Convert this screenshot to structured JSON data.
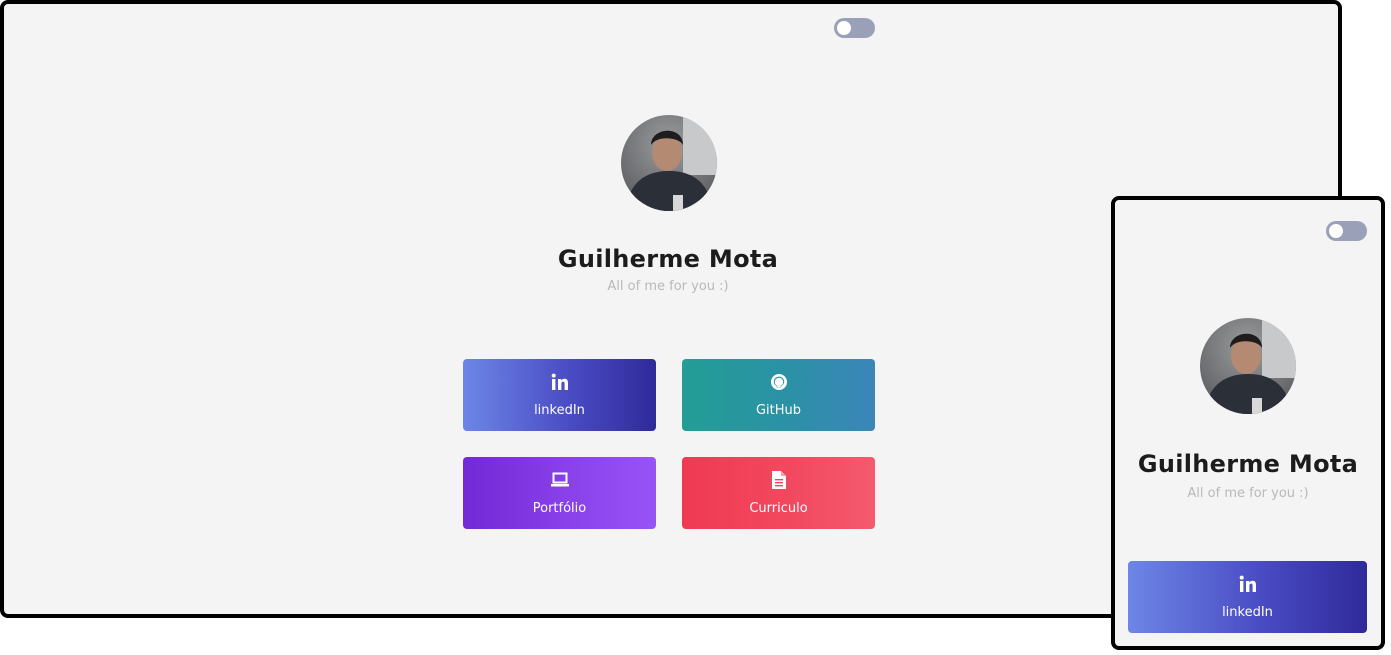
{
  "profile": {
    "name": "Guilherme Mota",
    "tagline": "All of me for you :)"
  },
  "theme_toggle": {
    "state": "off"
  },
  "links": [
    {
      "label": "linkedIn",
      "icon": "linkedin-icon",
      "gradient": [
        "#6d86e6",
        "#2f2a9a"
      ]
    },
    {
      "label": "GitHub",
      "icon": "github-icon",
      "gradient": [
        "#229e95",
        "#3a86b8"
      ]
    },
    {
      "label": "Portfólio",
      "icon": "laptop-icon",
      "gradient": [
        "#7229d6",
        "#9853f7"
      ]
    },
    {
      "label": "Curriculo",
      "icon": "document-icon",
      "gradient": [
        "#ef3a52",
        "#f45a6e"
      ]
    }
  ],
  "colors": {
    "background": "#f4f4f4",
    "name": "#1c1c1c",
    "tagline": "#b9b9b9",
    "toggle": "#9aa0b8"
  }
}
